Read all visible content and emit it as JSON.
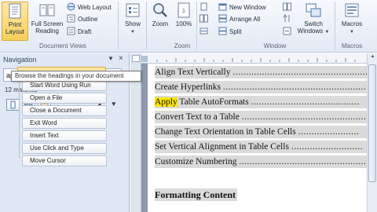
{
  "ribbon": {
    "document_views": {
      "group_label": "Document Views",
      "print_layout": "Print Layout",
      "full_screen_reading": "Full Screen Reading",
      "web_layout": "Web Layout",
      "outline": "Outline",
      "draft": "Draft"
    },
    "show": {
      "label": "Show"
    },
    "zoom": {
      "group_label": "Zoom",
      "zoom": "Zoom",
      "percent": "100%"
    },
    "window": {
      "group_label": "Window",
      "new_window": "New Window",
      "arrange_all": "Arrange All",
      "split": "Split",
      "switch_windows": "Switch Windows"
    },
    "macros": {
      "group_label": "Macros",
      "macros": "Macros"
    }
  },
  "navigation": {
    "title": "Navigation",
    "close_glyph": "×",
    "search_value": "apply",
    "matches": "12 matches",
    "tooltip": "Browse the headings in your document",
    "headings": [
      "Start Word Using Run",
      "Open a File",
      "Close a Document",
      "Exit Word",
      "Insert Text",
      "Use Click and Type",
      "Move Cursor"
    ]
  },
  "document": {
    "toc": [
      {
        "pre": "",
        "mark": "",
        "post": "Align Text Vertically "
      },
      {
        "pre": "",
        "mark": "",
        "post": "Create Hyperlinks "
      },
      {
        "pre": "",
        "mark": "Apply",
        "post": " Table AutoFormats "
      },
      {
        "pre": "",
        "mark": "",
        "post": "Convert Text to a Table "
      },
      {
        "pre": "",
        "mark": "",
        "post": "Change Text Orientation in Table Cells "
      },
      {
        "pre": "",
        "mark": "",
        "post": "Set Vertical Alignment in Table Cells "
      },
      {
        "pre": "",
        "mark": "",
        "post": "Customize Numbering "
      }
    ],
    "section_heading": "Formatting Content"
  },
  "colors": {
    "ribbon_bg": "#e3eaf4",
    "active_button": "#f8cf5a",
    "highlight": "#ffe600",
    "page_bg": "#ffffff",
    "doc_backdrop": "#8d9aab"
  }
}
